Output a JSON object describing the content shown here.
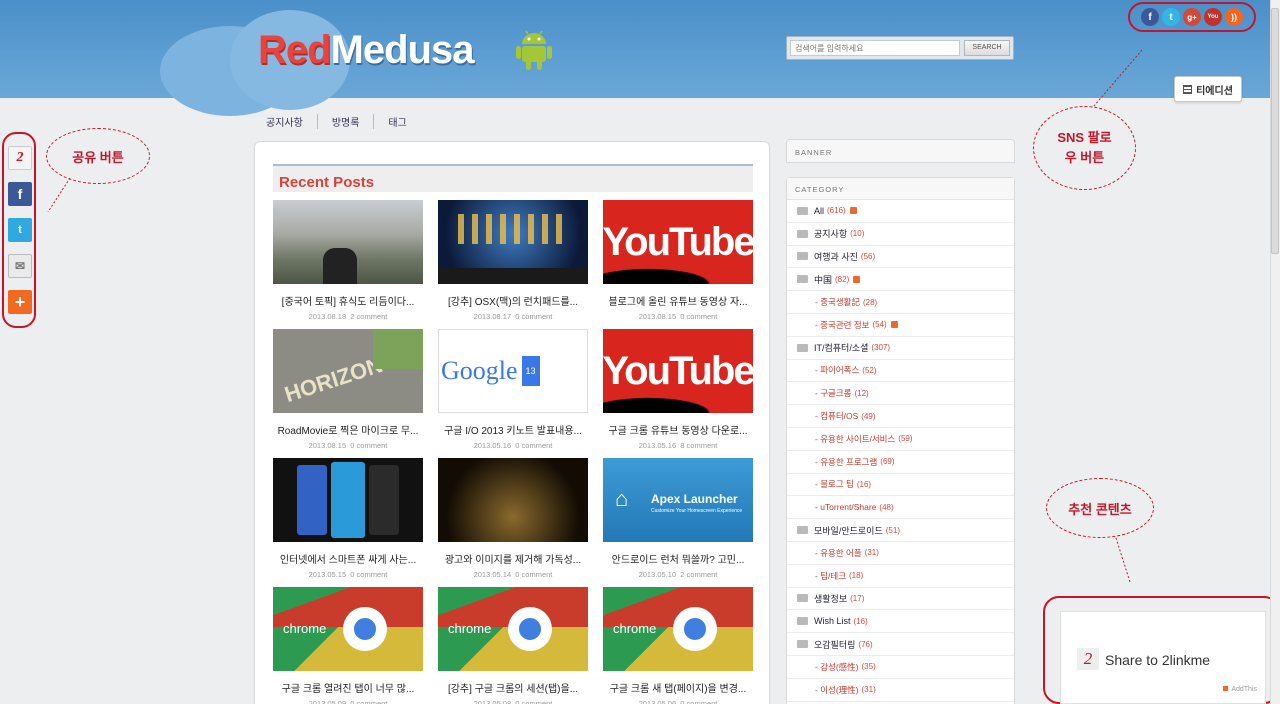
{
  "header": {
    "logo_red": "Red",
    "logo_white": "Medusa",
    "search_placeholder": "검색어를 입력하세요",
    "search_button": "SEARCH",
    "edition_label": "티에디션"
  },
  "nav": [
    "공지사항",
    "방명록",
    "태그"
  ],
  "recent_posts": {
    "title": "Recent Posts",
    "posts": [
      {
        "title": "[중국어 토픽] 휴식도 리듬이다...",
        "date": "2013.08.18",
        "comments": "2 comment",
        "thumb": "city"
      },
      {
        "title": "[강추] OSX(맥)의 런치패드를...",
        "date": "2013.08.17",
        "comments": "0 comment",
        "thumb": "launchpad"
      },
      {
        "title": "블로그에 올린 유튜브 동영상 자...",
        "date": "2013.08.15",
        "comments": "0 comment",
        "thumb": "youtube"
      },
      {
        "title": "RoadMovie로 찍은 마이크로 무...",
        "date": "2013.08.15",
        "comments": "0 comment",
        "thumb": "road"
      },
      {
        "title": "구글 I/O 2013 키노트 발표내용...",
        "date": "2013.05.16",
        "comments": "0 comment",
        "thumb": "googleio"
      },
      {
        "title": "구글 크롬 유튜브 동영상 다운로...",
        "date": "2013.05.16",
        "comments": "8 comment",
        "thumb": "youtube"
      },
      {
        "title": "인터넷에서 스마트폰 싸게 사는...",
        "date": "2013.05.15",
        "comments": "0 comment",
        "thumb": "phones"
      },
      {
        "title": "광고와 이미지를 제거해 가독성...",
        "date": "2013.05.14",
        "comments": "0 comment",
        "thumb": "book"
      },
      {
        "title": "안드로이드 런처 뭐쓸까? 고민...",
        "date": "2013.05.10",
        "comments": "2 comment",
        "thumb": "apex"
      },
      {
        "title": "구글 크롬 열려진 탭이 너무 많...",
        "date": "2013.05.09",
        "comments": "0 comment",
        "thumb": "chrome"
      },
      {
        "title": "[강추] 구글 크롬의 세션(탭)을...",
        "date": "2013.05.08",
        "comments": "0 comment",
        "thumb": "chrome"
      },
      {
        "title": "구글 크롬 새 탭(페이지)을 변경...",
        "date": "2013.05.06",
        "comments": "0 comment",
        "thumb": "chrome"
      }
    ]
  },
  "thumb_text": {
    "youtube_you": "You",
    "youtube_tube": "Tube",
    "google": "Google",
    "io_num": "13",
    "road": "HORIZON",
    "apex": "Apex Launcher",
    "apex_sub": "Customize Your Homescreen Experience",
    "chrome": "chrome"
  },
  "sidebar": {
    "banner_label": "BANNER",
    "category_label": "CATEGORY",
    "categories": [
      {
        "name": "All",
        "count": "(616)",
        "sub": false,
        "new": true
      },
      {
        "name": "공지사항",
        "count": "(10)",
        "sub": false,
        "new": false
      },
      {
        "name": "여행과 사진",
        "count": "(56)",
        "sub": false,
        "new": false
      },
      {
        "name": "中国",
        "count": "(82)",
        "sub": false,
        "new": true
      },
      {
        "name": "- 중국생활記",
        "count": "(28)",
        "sub": true,
        "new": false
      },
      {
        "name": "- 중국관련 정보",
        "count": "(54)",
        "sub": true,
        "new": true
      },
      {
        "name": "IT/컴퓨터/소셜",
        "count": "(307)",
        "sub": false,
        "new": false
      },
      {
        "name": "- 파이어폭스",
        "count": "(52)",
        "sub": true,
        "new": false
      },
      {
        "name": "- 구글크롬",
        "count": "(12)",
        "sub": true,
        "new": false
      },
      {
        "name": "- 컴퓨터/OS",
        "count": "(49)",
        "sub": true,
        "new": false
      },
      {
        "name": "- 유용한 사이트/서비스",
        "count": "(59)",
        "sub": true,
        "new": false
      },
      {
        "name": "- 유용한 프로그램",
        "count": "(69)",
        "sub": true,
        "new": false
      },
      {
        "name": "- 블로그 팁",
        "count": "(16)",
        "sub": true,
        "new": false
      },
      {
        "name": "- uTorrent/Share",
        "count": "(48)",
        "sub": true,
        "new": false
      },
      {
        "name": "모바일/안드로이드",
        "count": "(51)",
        "sub": false,
        "new": false
      },
      {
        "name": "- 유용한 어플",
        "count": "(31)",
        "sub": true,
        "new": false
      },
      {
        "name": "- 팁/테크",
        "count": "(18)",
        "sub": true,
        "new": false
      },
      {
        "name": "생활정보",
        "count": "(17)",
        "sub": false,
        "new": false
      },
      {
        "name": "Wish List",
        "count": "(16)",
        "sub": false,
        "new": false
      },
      {
        "name": "오감필터링",
        "count": "(76)",
        "sub": false,
        "new": false
      },
      {
        "name": "- 감성(感性)",
        "count": "(35)",
        "sub": true,
        "new": false
      },
      {
        "name": "- 이성(理性)",
        "count": "(31)",
        "sub": true,
        "new": false
      }
    ]
  },
  "share_bar": {
    "buttons": [
      "2linkme",
      "facebook",
      "twitter",
      "email",
      "more"
    ],
    "twolink_glyph": "2"
  },
  "annotations": {
    "share": "공유 버튼",
    "sns": "SNS 팔로\n우 버튼",
    "recommend": "추천 콘텐츠"
  },
  "recommend": {
    "label": "Share to 2linkme",
    "icon_glyph": "2",
    "powered": "AddThis"
  },
  "colors": {
    "header_blue": "#5e9fd3",
    "accent_red": "#d64338",
    "annotation_red": "#c4162a"
  }
}
